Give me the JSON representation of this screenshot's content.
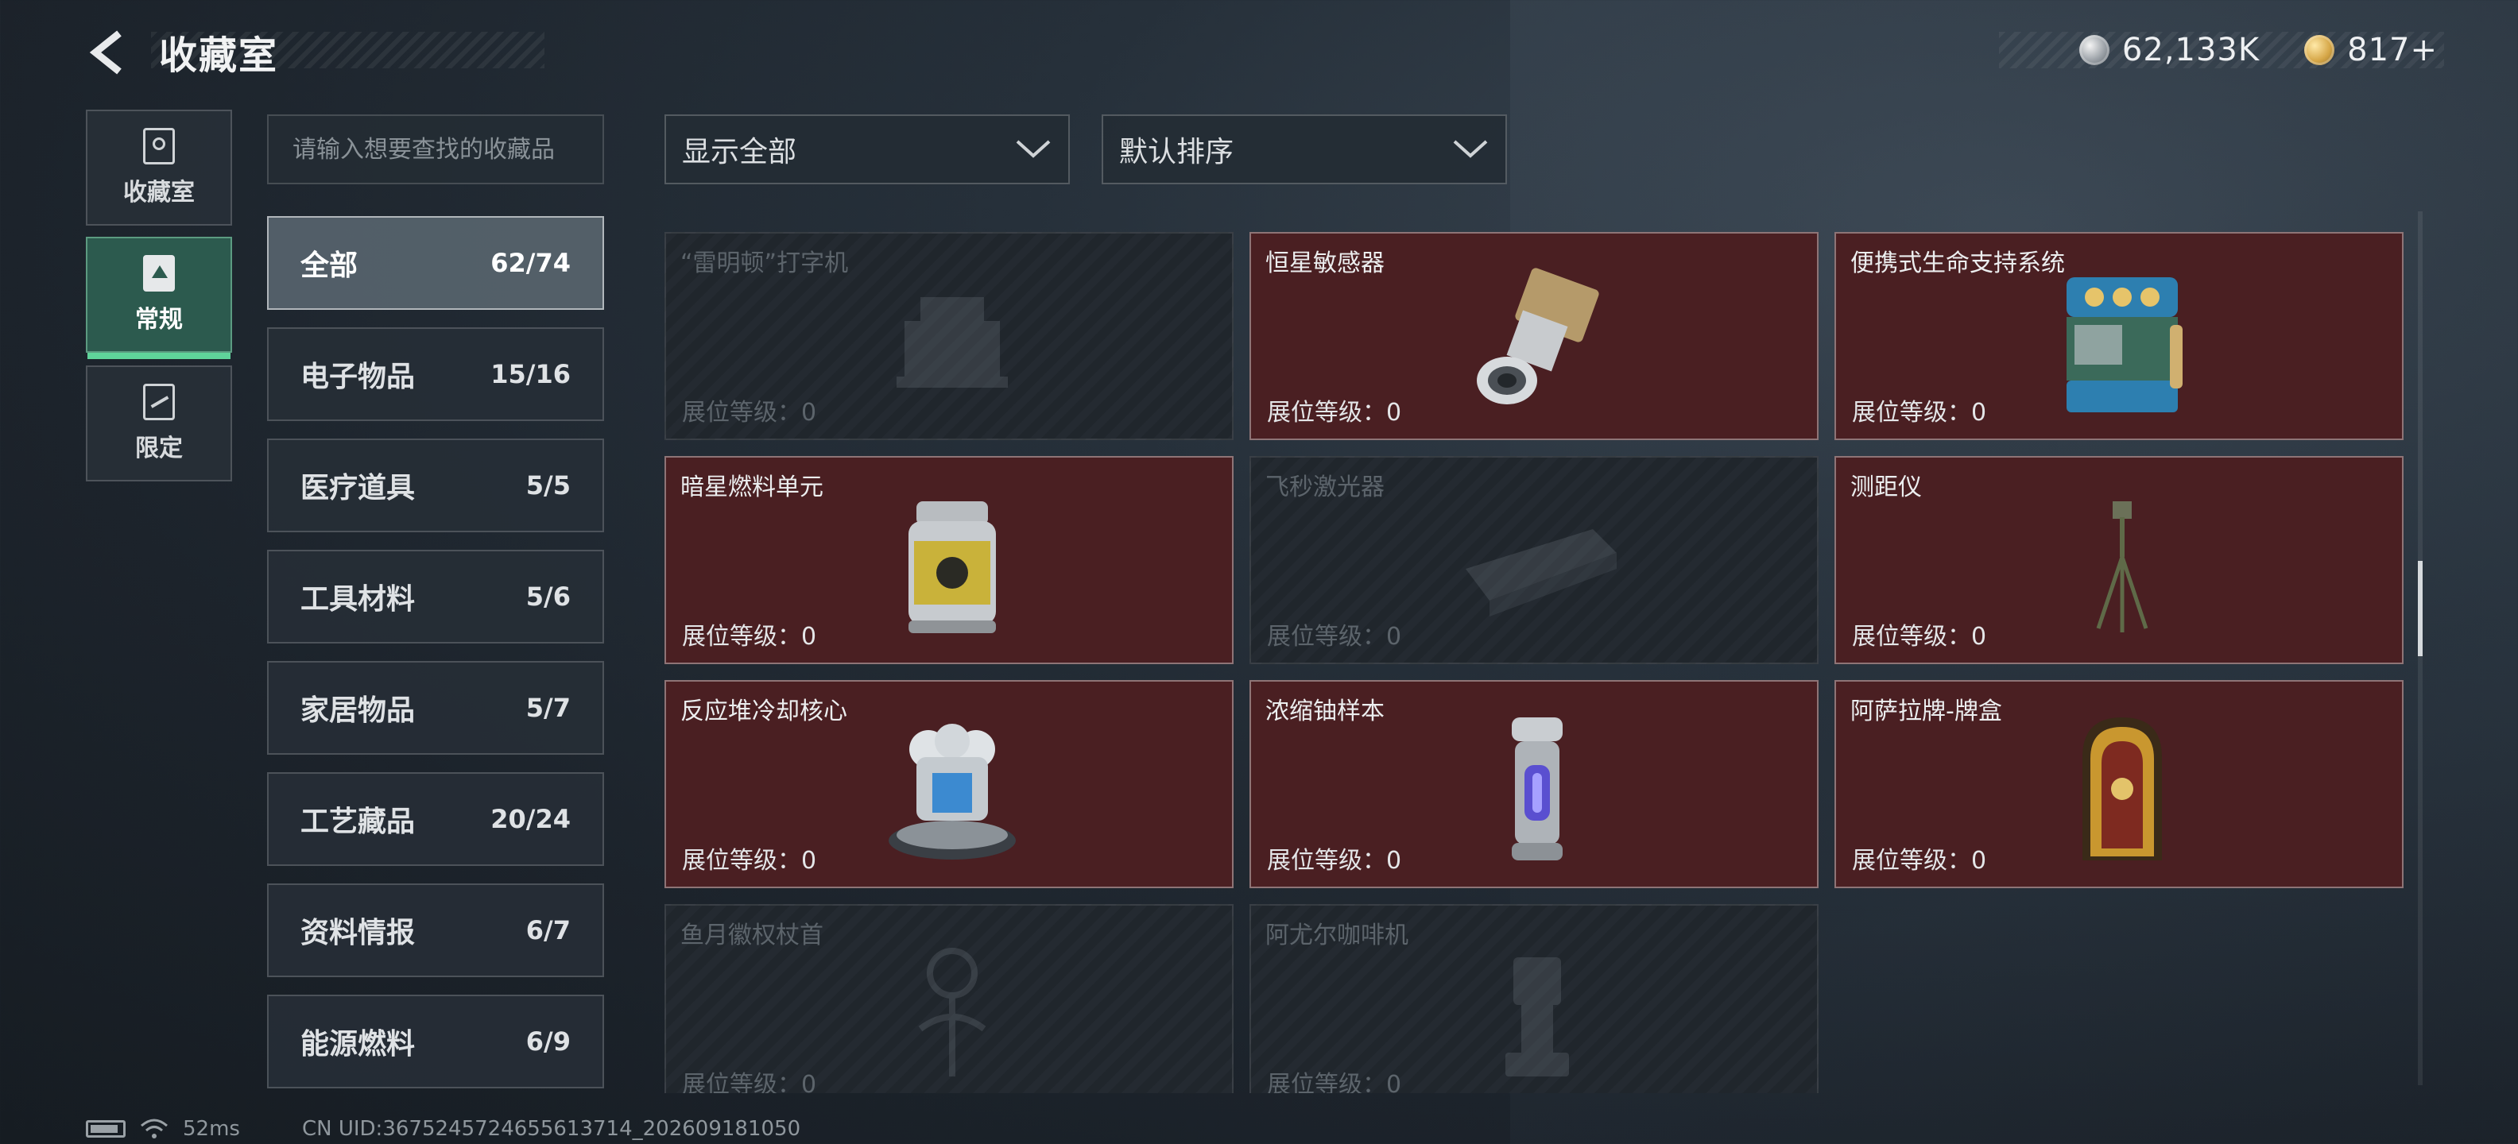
{
  "header": {
    "title": "收藏室",
    "currency": [
      {
        "icon": "silver-coin-icon",
        "value": "62,133K"
      },
      {
        "icon": "gold-coin-icon",
        "value": "817+"
      }
    ]
  },
  "mode_tabs": [
    {
      "label": "收藏室",
      "icon": "vault-icon",
      "active": false
    },
    {
      "label": "常规",
      "icon": "collection-card-icon",
      "active": true
    },
    {
      "label": "限定",
      "icon": "limited-card-icon",
      "active": false
    }
  ],
  "search": {
    "placeholder": "请输入想要查找的收藏品"
  },
  "categories": [
    {
      "name": "全部",
      "count": "62/74",
      "active": true
    },
    {
      "name": "电子物品",
      "count": "15/16",
      "active": false
    },
    {
      "name": "医疗道具",
      "count": "5/5",
      "active": false
    },
    {
      "name": "工具材料",
      "count": "5/6",
      "active": false
    },
    {
      "name": "家居物品",
      "count": "5/7",
      "active": false
    },
    {
      "name": "工艺藏品",
      "count": "20/24",
      "active": false
    },
    {
      "name": "资料情报",
      "count": "6/7",
      "active": false
    },
    {
      "name": "能源燃料",
      "count": "6/9",
      "active": false
    }
  ],
  "filters": {
    "display": "显示全部",
    "sort": "默认排序"
  },
  "items": [
    {
      "name": "“雷明顿”打字机",
      "level": "展位等级：0",
      "owned": false,
      "icon": "typewriter-icon"
    },
    {
      "name": "恒星敏感器",
      "level": "展位等级：0",
      "owned": true,
      "icon": "star-sensor-icon"
    },
    {
      "name": "便携式生命支持系统",
      "level": "展位等级：0",
      "owned": true,
      "icon": "life-support-icon"
    },
    {
      "name": "暗星燃料单元",
      "level": "展位等级：0",
      "owned": true,
      "icon": "fuel-canister-icon"
    },
    {
      "name": "飞秒激光器",
      "level": "展位等级：0",
      "owned": false,
      "icon": "laser-icon"
    },
    {
      "name": "测距仪",
      "level": "展位等级：0",
      "owned": true,
      "icon": "rangefinder-icon"
    },
    {
      "name": "反应堆冷却核心",
      "level": "展位等级：0",
      "owned": true,
      "icon": "reactor-core-icon"
    },
    {
      "name": "浓缩铀样本",
      "level": "展位等级：0",
      "owned": true,
      "icon": "uranium-sample-icon"
    },
    {
      "name": "阿萨拉牌-牌盒",
      "level": "展位等级：0",
      "owned": true,
      "icon": "card-box-icon"
    },
    {
      "name": "鱼月徽权杖首",
      "level": "展位等级：0",
      "owned": false,
      "icon": "scepter-head-icon"
    },
    {
      "name": "阿尤尔咖啡机",
      "level": "展位等级：0",
      "owned": false,
      "icon": "coffee-machine-icon"
    }
  ],
  "footer": {
    "ping": "52ms",
    "uid": "CN UID:3675245724655613714_202609181050"
  },
  "colors": {
    "owned_card": "#4a1f22",
    "active_tab": "#2c5a4e",
    "accent_green": "#5fd39a"
  }
}
